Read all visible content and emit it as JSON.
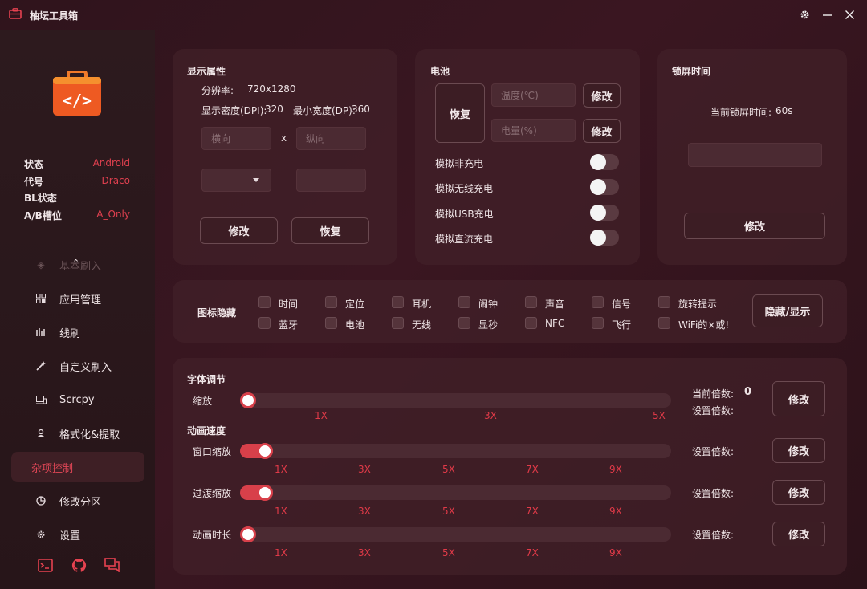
{
  "window": {
    "title": "柚坛工具箱"
  },
  "sidebar": {
    "info": [
      {
        "key": "状态",
        "value": "Android"
      },
      {
        "key": "代号",
        "value": "Draco"
      },
      {
        "key": "BL状态",
        "value": "—"
      },
      {
        "key": "A/B槽位",
        "value": "A_Only"
      }
    ],
    "nav": [
      {
        "label": "基本刷入",
        "icon": "flash-icon"
      },
      {
        "label": "应用管理",
        "icon": "apps-icon"
      },
      {
        "label": "线刷",
        "icon": "line-flash-icon"
      },
      {
        "label": "自定义刷入",
        "icon": "wand-icon"
      },
      {
        "label": "Scrcpy",
        "icon": "screen-icon"
      },
      {
        "label": "格式化&提取",
        "icon": "format-icon"
      },
      {
        "label": "杂项控制",
        "icon": ""
      },
      {
        "label": "修改分区",
        "icon": "partition-icon"
      },
      {
        "label": "设置",
        "icon": "settings-icon"
      }
    ]
  },
  "display": {
    "title": "显示属性",
    "resolution_label": "分辨率:",
    "resolution_value": "720x1280",
    "dpi_label": "显示密度(DPI):",
    "dpi_value": "320",
    "min_width_label": "最小宽度(DP):",
    "min_width_value": "360",
    "horizontal_placeholder": "横向",
    "times": "x",
    "vertical_placeholder": "纵向",
    "modify": "修改",
    "restore": "恢复"
  },
  "battery": {
    "title": "电池",
    "restore": "恢复",
    "temp_placeholder": "温度(℃)",
    "level_placeholder": "电量(%)",
    "modify": "修改",
    "toggles": [
      "模拟非充电",
      "模拟无线充电",
      "模拟USB充电",
      "模拟直流充电"
    ]
  },
  "lock": {
    "title": "锁屏时间",
    "current_label": "当前锁屏时间:",
    "current_value": "60s",
    "modify": "修改"
  },
  "icons_hide": {
    "title": "图标隐藏",
    "row1": [
      "时间",
      "定位",
      "耳机",
      "闹钟",
      "声音",
      "信号",
      "旋转提示"
    ],
    "row2": [
      "蓝牙",
      "电池",
      "无线",
      "显秒",
      "NFC",
      "飞行",
      "WiFi的×或!"
    ],
    "button": "隐藏/显示"
  },
  "font": {
    "title": "字体调节",
    "scale_label": "缩放",
    "scale_value_fraction": 0.0,
    "ticks": [
      "1X",
      "3X",
      "5X"
    ],
    "current_label": "当前倍数:",
    "current_value": "0",
    "set_label": "设置倍数:",
    "modify": "修改"
  },
  "animation": {
    "title": "动画速度",
    "ticks": [
      "1X",
      "3X",
      "5X",
      "7X",
      "9X"
    ],
    "set_label": "设置倍数:",
    "modify": "修改",
    "rows": [
      {
        "label": "窗口缩放",
        "value_fraction": 0.04
      },
      {
        "label": "过渡缩放",
        "value_fraction": 0.04
      },
      {
        "label": "动画时长",
        "value_fraction": 0.0
      }
    ]
  }
}
